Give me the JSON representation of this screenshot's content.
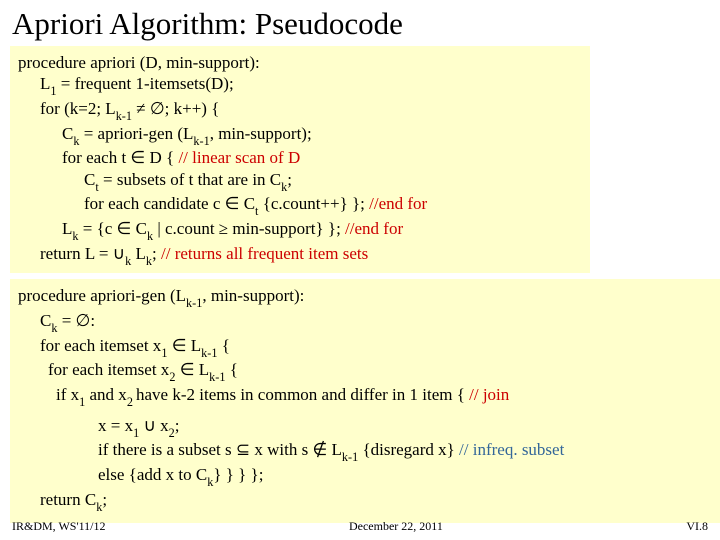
{
  "title": "Apriori Algorithm: Pseudocode",
  "block1": {
    "l1a": "procedure apriori (D, min-support):",
    "l2a": "L",
    "l2b": "1",
    "l2c": " = frequent 1-itemsets(D);",
    "l3a": "for (k=2; L",
    "l3b": "k-1",
    "l3c": " ≠ ∅; k++) {",
    "l4a": "C",
    "l4b": "k",
    "l4c": " = apriori-gen (L",
    "l4d": "k-1",
    "l4e": ", min-support);",
    "l5a": "for each t ∈ D {   ",
    "l5b": "// linear scan of D",
    "l6a": "C",
    "l6b": "t",
    "l6c": " = subsets of t that are in C",
    "l6d": "k",
    "l6e": ";",
    "l7a": "for each candidate c ∈ C",
    "l7b": "t",
    "l7c": "  {c.count++} }; ",
    "l7d": "//end for",
    "l8a": "L",
    "l8b": "k",
    "l8c": " = {c ∈ C",
    "l8d": "k",
    "l8e": " | c.count ≥ min-support} }; ",
    "l8f": "//end for",
    "l9a": "return L = ∪",
    "l9b": "k",
    "l9c": " L",
    "l9d": "k",
    "l9e": ";   ",
    "l9f": "// returns all frequent item sets"
  },
  "block2": {
    "l1a": "procedure apriori-gen (L",
    "l1b": "k-1",
    "l1c": ", min-support):",
    "l2a": "C",
    "l2b": "k",
    "l2c": " = ∅:",
    "l3a": "for each itemset x",
    "l3b": "1",
    "l3c": " ∈ L",
    "l3d": "k-1",
    "l3e": " {",
    "l4a": "for each itemset x",
    "l4b": "2",
    "l4c": " ∈ L",
    "l4d": "k-1",
    "l4e": " {",
    "l5a": "if x",
    "l5b": "1",
    "l5c": " and x",
    "l5d": "2 ",
    "l5e": "have k-2 items in common and differ in 1 item {   ",
    "l5f": "// join",
    "l6a": "x = x",
    "l6b": "1",
    "l6c": " ∪ x",
    "l6d": "2",
    "l6e": ";",
    "l7a": "if there is a subset s ⊆ x with s ∉ L",
    "l7b": "k-1",
    "l7c": " {disregard x}    ",
    "l7d": "// infreq. subset",
    "l8a": "else {add x to C",
    "l8b": "k",
    "l8c": "} } } };",
    "l9a": "return C",
    "l9b": "k",
    "l9c": ";"
  },
  "footer": {
    "left": "IR&DM, WS'11/12",
    "center": "December 22, 2011",
    "right": "VI.8"
  }
}
